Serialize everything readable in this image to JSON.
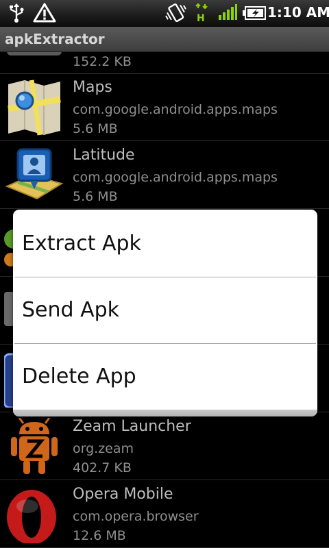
{
  "status_bar": {
    "time": "1:10 AM",
    "icons": [
      "usb-icon",
      "warning-icon",
      "vibrate-icon",
      "h-data-icon",
      "signal-icon",
      "battery-charging-icon"
    ]
  },
  "app": {
    "title": "apkExtractor"
  },
  "apps": [
    {
      "name": "",
      "package": "",
      "size": "152.2 KB",
      "icon": "partial-app-icon"
    },
    {
      "name": "Maps",
      "package": "com.google.android.apps.maps",
      "size": "5.6 MB",
      "icon": "maps-icon"
    },
    {
      "name": "Latitude",
      "package": "com.google.android.apps.maps",
      "size": "5.6 MB",
      "icon": "latitude-icon"
    },
    {
      "name": "Zeam Launcher",
      "package": "org.zeam",
      "size": "402.7 KB",
      "icon": "zeam-android-icon"
    },
    {
      "name": "Opera Mobile",
      "package": "com.opera.browser",
      "size": "12.6 MB",
      "icon": "opera-icon"
    }
  ],
  "context_menu": {
    "items": [
      {
        "label": "Extract Apk"
      },
      {
        "label": "Send Apk"
      },
      {
        "label": "Delete App"
      }
    ]
  },
  "colors": {
    "background": "#000000",
    "menu_background": "#ffffff",
    "status_green": "#8fd400"
  }
}
